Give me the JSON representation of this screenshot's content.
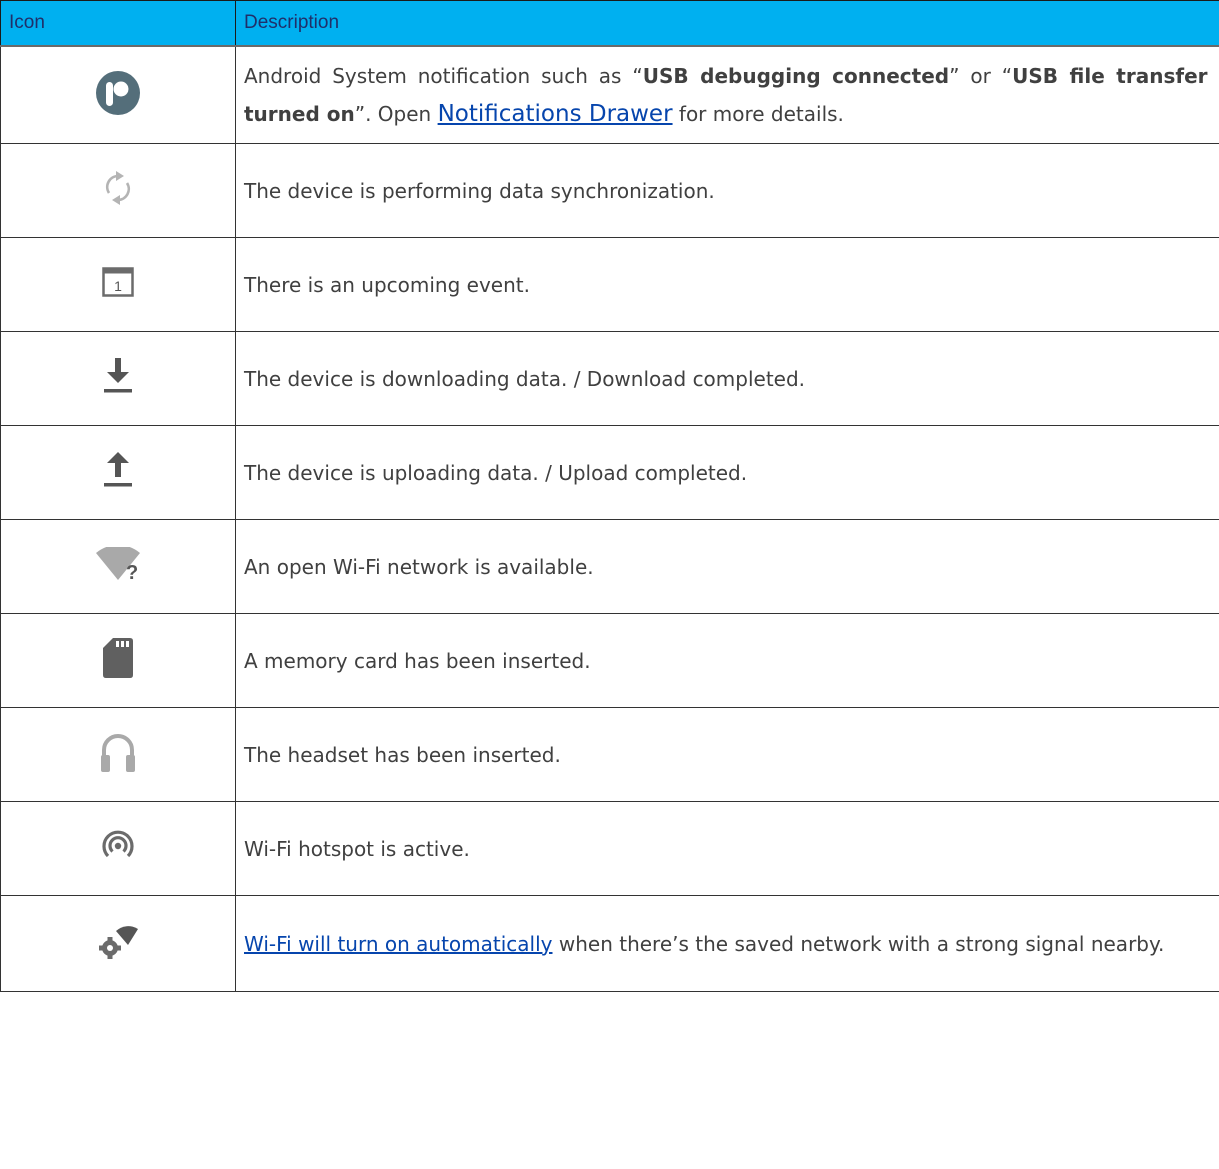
{
  "table": {
    "header": {
      "icon": "Icon",
      "description": "Description"
    },
    "rows": [
      {
        "icon": "android-system-notification-icon",
        "desc": {
          "p1": "Android System notification such as “",
          "b1": "USB debugging connected",
          "p2": "” or “",
          "b2": "USB file transfer turned on",
          "p3": "”. Open ",
          "link": "Notifications Drawer",
          "p4": " for more details."
        }
      },
      {
        "icon": "sync-icon",
        "text": "The device is performing data synchronization."
      },
      {
        "icon": "calendar-event-icon",
        "text": "There is an upcoming event."
      },
      {
        "icon": "download-icon",
        "text": "The device is downloading data. / Download completed."
      },
      {
        "icon": "upload-icon",
        "text": "The device is uploading data. / Upload completed."
      },
      {
        "icon": "open-wifi-network-icon",
        "text": "An open Wi-Fi network is available."
      },
      {
        "icon": "memory-card-icon",
        "text": "A memory card has been inserted."
      },
      {
        "icon": "headset-icon",
        "text": "The headset has been inserted."
      },
      {
        "icon": "wifi-hotspot-icon",
        "text": "Wi-Fi hotspot is active."
      },
      {
        "icon": "wifi-auto-on-icon",
        "desc": {
          "link": "Wi-Fi will turn on automatically",
          "p1": " when there’s the saved network with a strong signal nearby."
        }
      }
    ]
  },
  "colors": {
    "header_bg": "#00b0f0",
    "header_text": "#1f2f6a",
    "icon_gray": "#8a8a8a",
    "icon_dark": "#546e7a",
    "link": "#0645ad"
  }
}
